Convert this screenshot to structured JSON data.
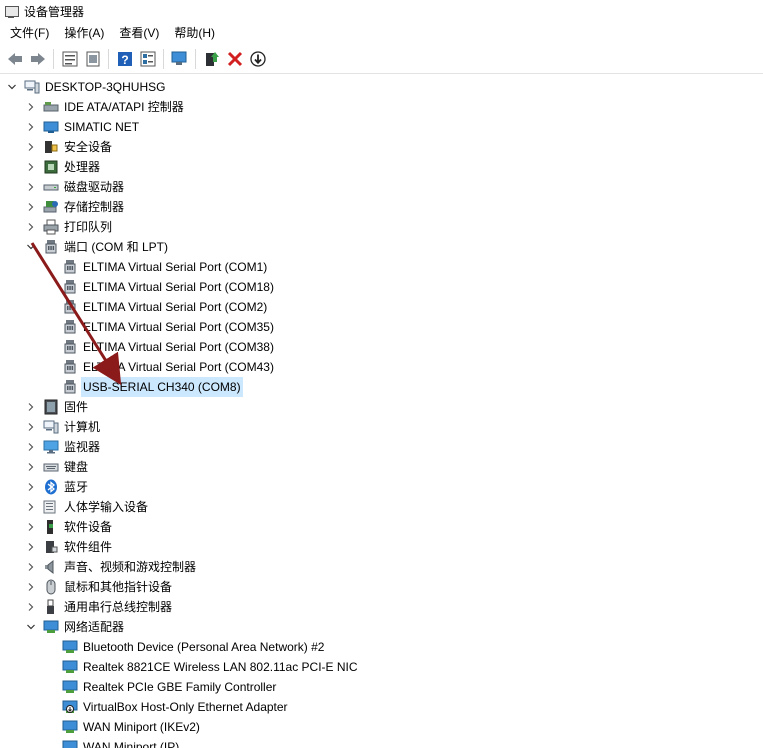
{
  "window": {
    "title": "设备管理器"
  },
  "menu": [
    "文件(F)",
    "操作(A)",
    "查看(V)",
    "帮助(H)"
  ],
  "toolbar": [
    {
      "name": "back-arrow-icon"
    },
    {
      "name": "forward-arrow-icon"
    },
    {
      "sep": true
    },
    {
      "name": "properties-icon"
    },
    {
      "name": "show-hidden-icon"
    },
    {
      "sep": true
    },
    {
      "name": "help-icon"
    },
    {
      "name": "view-by-icon"
    },
    {
      "sep": true
    },
    {
      "name": "scan-hardware-icon"
    },
    {
      "sep": true
    },
    {
      "name": "update-driver-icon"
    },
    {
      "name": "uninstall-device-icon"
    },
    {
      "name": "disable-device-icon"
    }
  ],
  "tree": [
    {
      "label": "DESKTOP-3QHUHSG",
      "level": 0,
      "expander": "expanded",
      "icon": "computer-icon"
    },
    {
      "label": "IDE ATA/ATAPI 控制器",
      "level": 1,
      "expander": "collapsed",
      "icon": "ide-controller-icon"
    },
    {
      "label": "SIMATIC NET",
      "level": 1,
      "expander": "collapsed",
      "icon": "network-icon"
    },
    {
      "label": "安全设备",
      "level": 1,
      "expander": "collapsed",
      "icon": "security-device-icon"
    },
    {
      "label": "处理器",
      "level": 1,
      "expander": "collapsed",
      "icon": "processor-icon"
    },
    {
      "label": "磁盘驱动器",
      "level": 1,
      "expander": "collapsed",
      "icon": "disk-drive-icon"
    },
    {
      "label": "存储控制器",
      "level": 1,
      "expander": "collapsed",
      "icon": "storage-controller-icon"
    },
    {
      "label": "打印队列",
      "level": 1,
      "expander": "collapsed",
      "icon": "printer-icon"
    },
    {
      "label": "端口 (COM 和 LPT)",
      "level": 1,
      "expander": "expanded",
      "icon": "port-icon"
    },
    {
      "label": "ELTIMA Virtual Serial Port (COM1)",
      "level": 2,
      "expander": "none",
      "icon": "port-icon"
    },
    {
      "label": "ELTIMA Virtual Serial Port (COM18)",
      "level": 2,
      "expander": "none",
      "icon": "port-icon"
    },
    {
      "label": "ELTIMA Virtual Serial Port (COM2)",
      "level": 2,
      "expander": "none",
      "icon": "port-icon"
    },
    {
      "label": "ELTIMA Virtual Serial Port (COM35)",
      "level": 2,
      "expander": "none",
      "icon": "port-icon"
    },
    {
      "label": "ELTIMA Virtual Serial Port (COM38)",
      "level": 2,
      "expander": "none",
      "icon": "port-icon"
    },
    {
      "label": "ELTIMA Virtual Serial Port (COM43)",
      "level": 2,
      "expander": "none",
      "icon": "port-icon"
    },
    {
      "label": "USB-SERIAL CH340 (COM8)",
      "level": 2,
      "expander": "none",
      "icon": "port-icon",
      "selected": true
    },
    {
      "label": "固件",
      "level": 1,
      "expander": "collapsed",
      "icon": "firmware-icon"
    },
    {
      "label": "计算机",
      "level": 1,
      "expander": "collapsed",
      "icon": "computer-icon"
    },
    {
      "label": "监视器",
      "level": 1,
      "expander": "collapsed",
      "icon": "monitor-icon"
    },
    {
      "label": "键盘",
      "level": 1,
      "expander": "collapsed",
      "icon": "keyboard-icon"
    },
    {
      "label": "蓝牙",
      "level": 1,
      "expander": "collapsed",
      "icon": "bluetooth-icon"
    },
    {
      "label": "人体学输入设备",
      "level": 1,
      "expander": "collapsed",
      "icon": "hid-icon"
    },
    {
      "label": "软件设备",
      "level": 1,
      "expander": "collapsed",
      "icon": "software-device-icon"
    },
    {
      "label": "软件组件",
      "level": 1,
      "expander": "collapsed",
      "icon": "software-component-icon"
    },
    {
      "label": "声音、视频和游戏控制器",
      "level": 1,
      "expander": "collapsed",
      "icon": "speaker-icon"
    },
    {
      "label": "鼠标和其他指针设备",
      "level": 1,
      "expander": "collapsed",
      "icon": "mouse-icon"
    },
    {
      "label": "通用串行总线控制器",
      "level": 1,
      "expander": "collapsed",
      "icon": "usb-icon"
    },
    {
      "label": "网络适配器",
      "level": 1,
      "expander": "expanded",
      "icon": "network-adapter-icon"
    },
    {
      "label": "Bluetooth Device (Personal Area Network) #2",
      "level": 2,
      "expander": "none",
      "icon": "network-adapter-icon"
    },
    {
      "label": "Realtek 8821CE Wireless LAN 802.11ac PCI-E NIC",
      "level": 2,
      "expander": "none",
      "icon": "network-adapter-icon"
    },
    {
      "label": "Realtek PCIe GBE Family Controller",
      "level": 2,
      "expander": "none",
      "icon": "network-adapter-icon"
    },
    {
      "label": "VirtualBox Host-Only Ethernet Adapter",
      "level": 2,
      "expander": "none",
      "icon": "network-adapter-disabled-icon"
    },
    {
      "label": "WAN Miniport (IKEv2)",
      "level": 2,
      "expander": "none",
      "icon": "network-adapter-icon"
    },
    {
      "label": "WAN Miniport (IP)",
      "level": 2,
      "expander": "none",
      "icon": "network-adapter-icon"
    }
  ],
  "annotation": {
    "arrow_color": "#8b1a1a"
  }
}
